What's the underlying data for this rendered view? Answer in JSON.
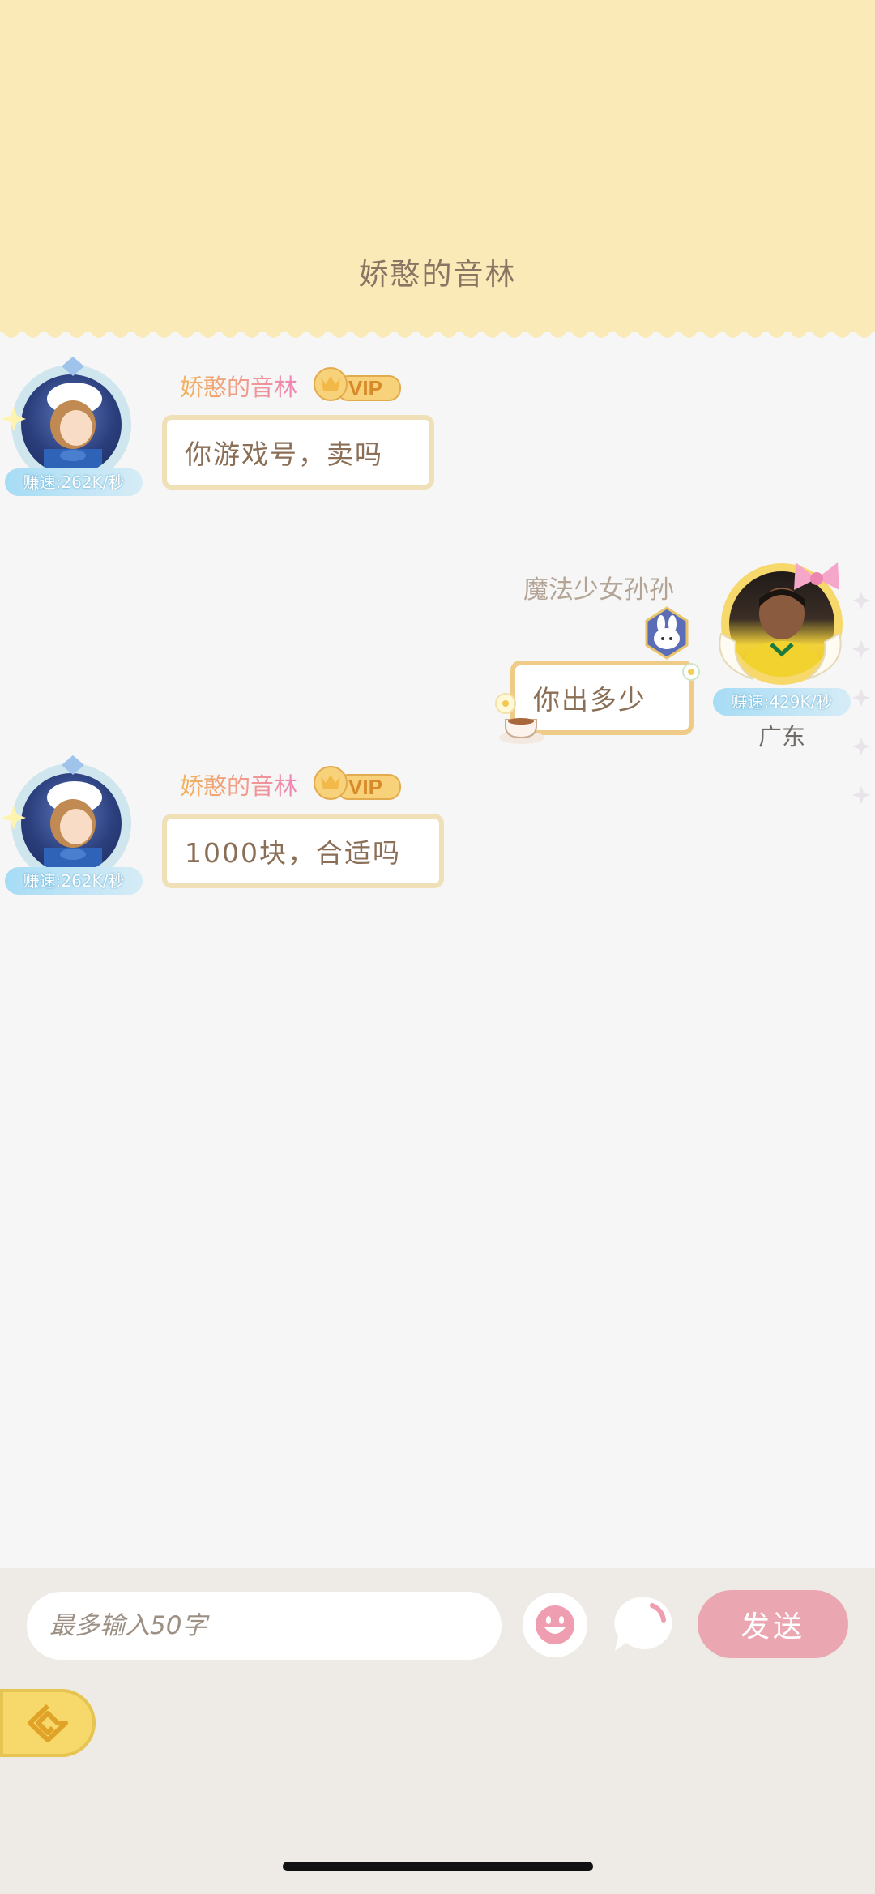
{
  "header": {
    "title": "娇憨的音林"
  },
  "messages": [
    {
      "side": "left",
      "sender": "娇憨的音林",
      "vip": "VIP",
      "speed": "赚速:262K/秒",
      "text": "你游戏号，卖吗"
    },
    {
      "side": "right",
      "sender": "魔法少女孙孙",
      "speed": "赚速:429K/秒",
      "region": "广东",
      "text": "你出多少"
    },
    {
      "side": "left",
      "sender": "娇憨的音林",
      "vip": "VIP",
      "speed": "赚速:262K/秒",
      "text": "1000块，合适吗"
    }
  ],
  "composer": {
    "placeholder": "最多输入50字",
    "send_label": "发送"
  },
  "colors": {
    "header_bg": "#faeab8",
    "send_button": "#eaa7b2",
    "back_button": "#f7d86b",
    "bottom_panel": "#eeebe6"
  },
  "icons": [
    "emoji-icon",
    "chat-bubble-icon",
    "back-arrow-icon",
    "vip-crown-icon",
    "bunny-badge-icon"
  ]
}
